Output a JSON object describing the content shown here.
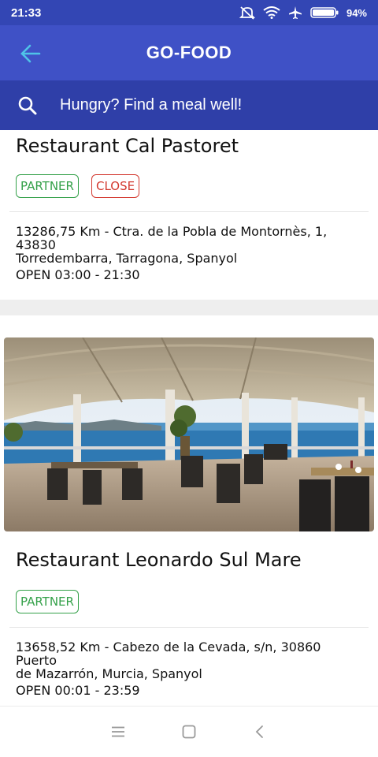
{
  "status_bar": {
    "time": "21:33",
    "battery": "94%",
    "icons": [
      "do-not-disturb-icon",
      "wifi-icon",
      "airplane-mode-icon",
      "battery-icon"
    ]
  },
  "app_bar": {
    "title": "GO-FOOD",
    "back_icon": "arrow-back-icon",
    "background": "#3f51c6"
  },
  "search": {
    "placeholder": "Hungry? Find a meal well!",
    "value": "",
    "icon": "search-icon",
    "background": "#2f3fa8"
  },
  "restaurants": [
    {
      "name": "Restaurant Cal Pastoret",
      "badges": [
        "PARTNER",
        "CLOSE"
      ],
      "address_line1": "13286,75 Km - Ctra. de la Pobla de Montornès, 1, 43830",
      "address_line2": "Torredembarra, Tarragona, Spanyol",
      "hours": "OPEN 03:00 - 21:30"
    },
    {
      "name": "Restaurant Leonardo Sul Mare",
      "badges": [
        "PARTNER"
      ],
      "address_line1": "13658,52 Km - Cabezo de la Cevada, s/n, 30860 Puerto",
      "address_line2": "de Mazarrón, Murcia, Spanyol",
      "hours": "OPEN 00:01 - 23:59",
      "photo": "restaurant-terrace-sea-view"
    }
  ],
  "colors": {
    "partner": "#35a14a",
    "close": "#d33a30",
    "status_bar": "#3346b4"
  },
  "nav_bar": {
    "icons": [
      "menu-icon",
      "home-square-icon",
      "back-chevron-icon"
    ]
  }
}
